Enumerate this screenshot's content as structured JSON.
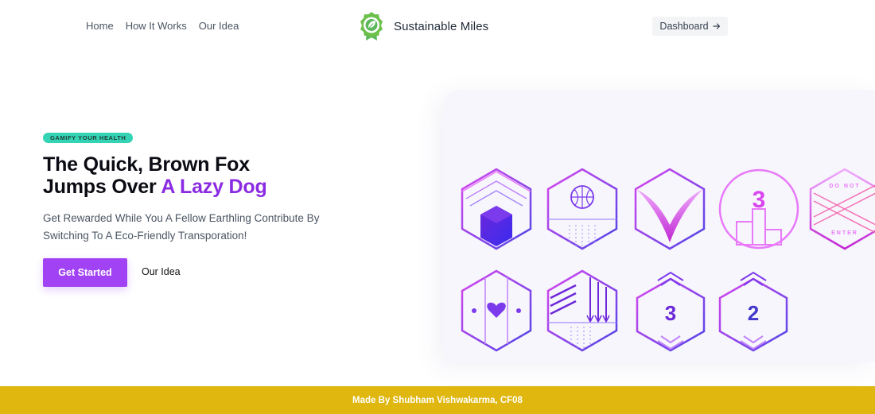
{
  "nav": {
    "links": [
      "Home",
      "How It Works",
      "Our Idea"
    ],
    "brand_name": "Sustainable Miles",
    "brand_icon": "leaf-award-icon",
    "dashboard_label": "Dashboard",
    "dashboard_icon": "arrow-right-icon"
  },
  "hero": {
    "tagline": "GAMIFY YOUR HEALTH",
    "headline_line1": "The Quick, Brown Fox",
    "headline_line2_prefix": "Jumps Over ",
    "headline_accent": "A Lazy Dog",
    "subtext": "Get Rewarded While You A Fellow Earthling Contribute By Switching To A Eco-Friendly Transporation!",
    "primary_button": "Get Started",
    "secondary_button": "Our Idea"
  },
  "badges": {
    "dont_enter_top": "DO NOT",
    "dont_enter_bottom": "ENTER",
    "level_3_circle": "3",
    "level_3_hex": "3",
    "level_2_hex": "2"
  },
  "colors": {
    "accent": "#8a2be2",
    "button": "#a142f4",
    "tagline_bg": "#34d3b4",
    "footer_bg": "#e0b70e",
    "brand_green": "#5cb85c"
  },
  "footer": {
    "text": "Made By Shubham Vishwakarma, CF08"
  }
}
